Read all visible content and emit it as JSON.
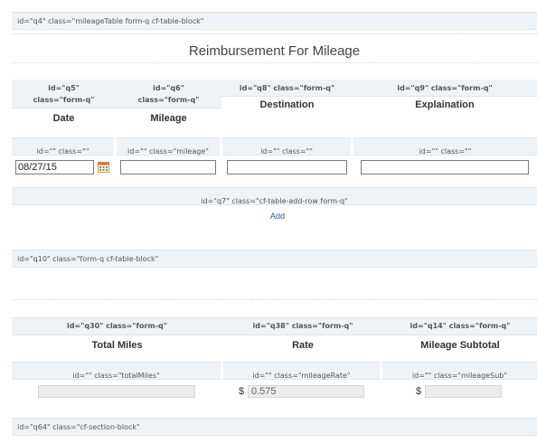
{
  "section_q4": {
    "tag": "id=\"q4\" class=\"mileageTable form-q cf-table-block\""
  },
  "title": "Reimbursement For Mileage",
  "columns": [
    {
      "tag_l1": "id=\"q5\"",
      "tag_l2": "class=\"form-q\"",
      "label": "Date"
    },
    {
      "tag_l1": "id=\"q6\"",
      "tag_l2": "class=\"form-q\"",
      "label": "Mileage"
    },
    {
      "tag": "id=\"q8\" class=\"form-q\"",
      "label": "Destination"
    },
    {
      "tag": "id=\"q9\" class=\"form-q\"",
      "label": "Explaination"
    }
  ],
  "row_tags": [
    "id=\"\" class=\"\"",
    "id=\"\" class=\"mileage\"",
    "id=\"\" class=\"\"",
    "id=\"\" class=\"\""
  ],
  "row": {
    "date_value": "08/27/15",
    "mileage_value": "",
    "destination_value": "",
    "explanation_value": ""
  },
  "add_row": {
    "tag": "id=\"q7\" class=\"cf-table-add-row form-q\"",
    "link": "Add"
  },
  "section_q10": {
    "tag": "id=\"q10\" class=\"form-q cf-table-block\""
  },
  "summary_columns": [
    {
      "tag": "id=\"q30\" class=\"form-q\"",
      "label": "Total Miles"
    },
    {
      "tag": "id=\"q38\" class=\"form-q\"",
      "label": "Rate"
    },
    {
      "tag": "id=\"q14\" class=\"form-q\"",
      "label": "Mileage Subtotal"
    }
  ],
  "summary_row_tags": [
    "id=\"\" class=\"totalMiles\"",
    "id=\"\" class=\"mileageRate\"",
    "id=\"\" class=\"mileageSub\""
  ],
  "summary": {
    "total_miles": "",
    "currency": "$",
    "rate": "0.575",
    "subtotal": ""
  },
  "section_q64": {
    "tag": "id=\"q64\" class=\"cf-section-block\""
  }
}
